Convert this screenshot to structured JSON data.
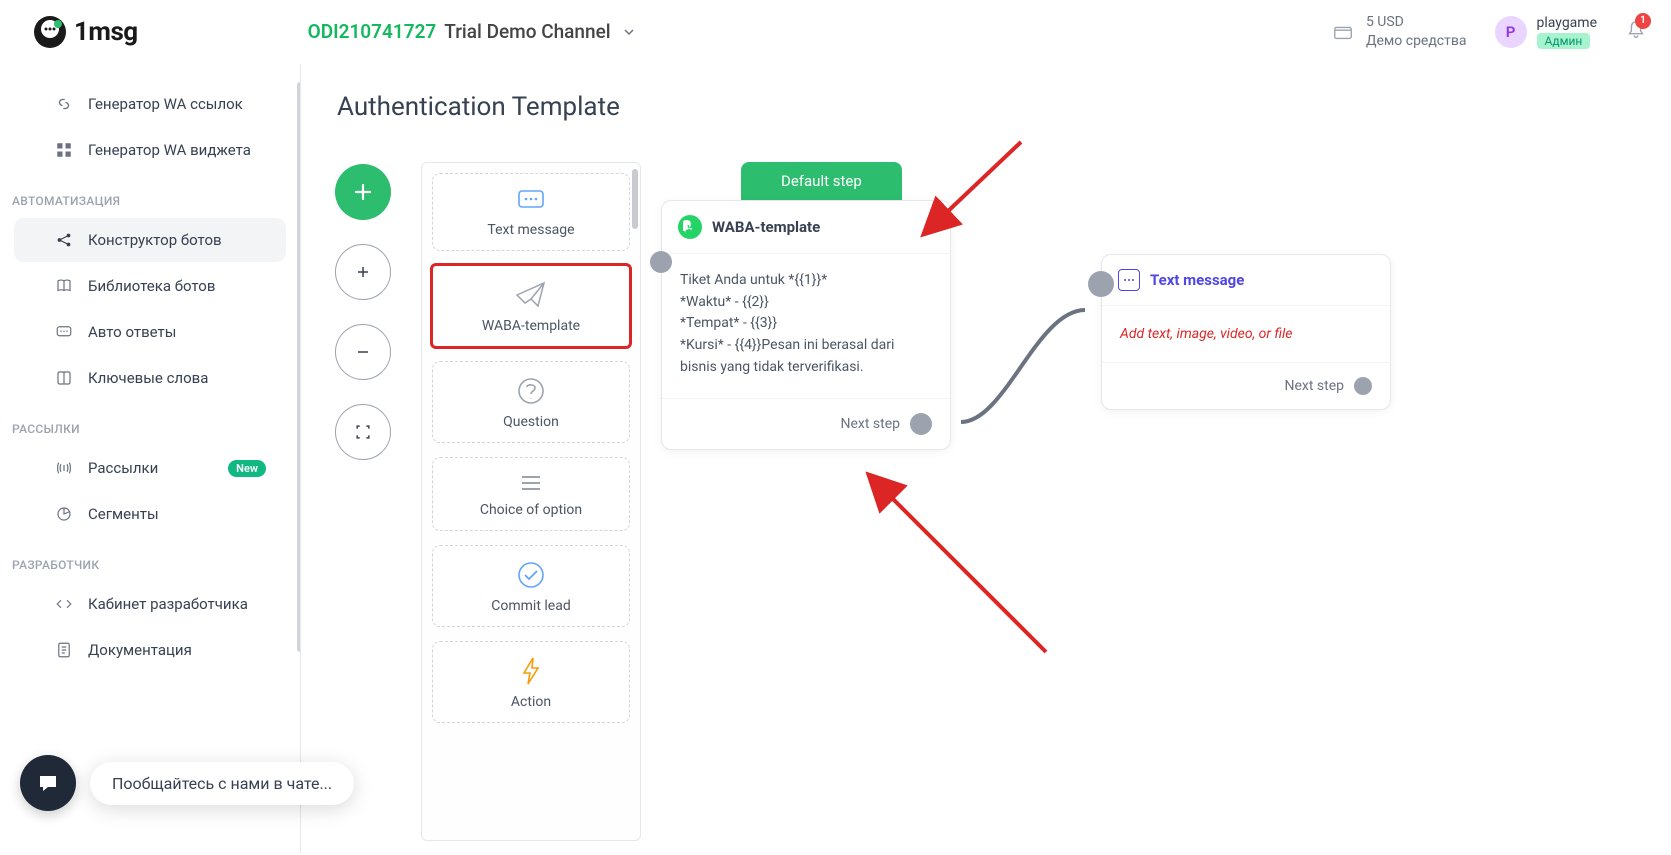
{
  "header": {
    "logo_text": "1msg",
    "channel_id": "ODI210741727",
    "channel_name": "Trial Demo Channel",
    "balance_amount": "5 USD",
    "balance_label": "Демо средства",
    "user_initial": "P",
    "user_name": "playgame",
    "user_role": "Админ",
    "notif_count": "1"
  },
  "sidebar": {
    "items_top": [
      {
        "label": "Генератор WA ссылок"
      },
      {
        "label": "Генератор WA виджета"
      }
    ],
    "section_auto": "АВТОМАТИЗАЦИЯ",
    "items_auto": [
      {
        "label": "Конструктор ботов",
        "active": true
      },
      {
        "label": "Библиотека ботов"
      },
      {
        "label": "Авто ответы"
      },
      {
        "label": "Ключевые слова"
      }
    ],
    "section_mail": "РАССЫЛКИ",
    "items_mail": [
      {
        "label": "Рассылки",
        "badge": "New"
      },
      {
        "label": "Сегменты"
      }
    ],
    "section_dev": "РАЗРАБОТЧИК",
    "items_dev": [
      {
        "label": "Кабинет разработчика"
      },
      {
        "label": "Документация"
      }
    ]
  },
  "chat_popup": "Пообщайтесь с нами в чате...",
  "page_title": "Authentication Template",
  "palette": [
    {
      "label": "Text message"
    },
    {
      "label": "WABA-template",
      "highlighted": true
    },
    {
      "label": "Question"
    },
    {
      "label": "Choice of option"
    },
    {
      "label": "Commit lead"
    },
    {
      "label": "Action"
    }
  ],
  "canvas": {
    "step_chip": "Default step",
    "card1_title": "WABA-template",
    "card1_body": "Tiket Anda untuk *{{1}}*\n*Waktu* - {{2}}\n*Tempat* - {{3}}\n*Kursi* - {{4}}Pesan ini berasal dari bisnis yang tidak terverifikasi.",
    "next_step": "Next step",
    "card2_title": "Text message",
    "card2_placeholder": "Add text, image, video, or file"
  }
}
